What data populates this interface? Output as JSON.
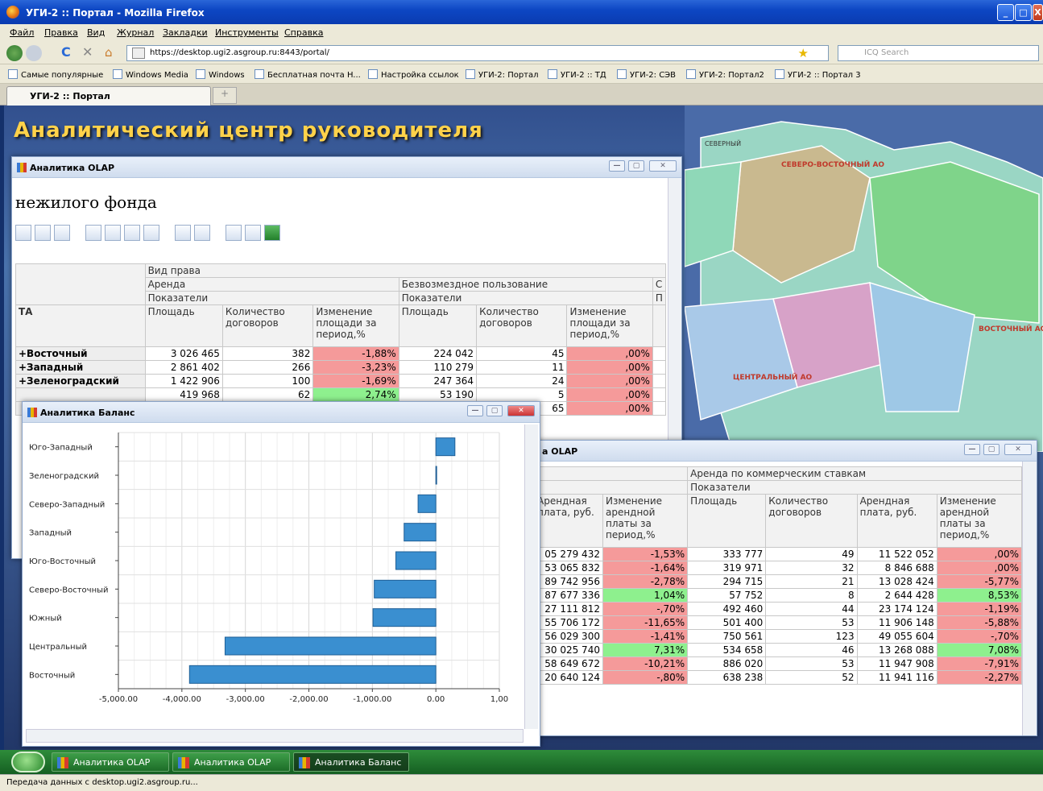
{
  "browser": {
    "title": "УГИ-2 :: Портал - Mozilla Firefox",
    "menu": [
      "Файл",
      "Правка",
      "Вид",
      "Журнал",
      "Закладки",
      "Инструменты",
      "Справка"
    ],
    "url": "https://desktop.ugi2.asgroup.ru:8443/portal/",
    "search_placeholder": "ICQ Search",
    "bookmarks": [
      "Самые популярные",
      "Windows Media",
      "Windows",
      "Бесплатная почта H...",
      "Настройка ссылок",
      "УГИ-2: Портал",
      "УГИ-2 :: ТД",
      "УГИ-2: СЭВ",
      "УГИ-2: Портал2",
      "УГИ-2 :: Портал 3"
    ],
    "tab": "УГИ-2 :: Портал",
    "status": "Передача данных с desktop.ugi2.asgroup.ru..."
  },
  "portal": {
    "title": "Аналитический центр руководителя",
    "map_labels": [
      "СЕВЕРО-ВОСТОЧНЫЙ АО",
      "ВОСТОЧНЫЙ АО",
      "ЦЕНТРАЛЬНЫЙ АО",
      "СЕВЕРНЫЙ"
    ]
  },
  "olap1": {
    "title": "Аналитика OLAP",
    "heading": "нежилого фонда",
    "h1": "Вид права",
    "h2a": "Аренда",
    "h2b": "Безвозмездное пользование",
    "h2c": "С",
    "h3a": "Показатели",
    "h3b": "Показатели",
    "h3c": "П",
    "row_header": "ТА",
    "cols": [
      "Площадь",
      "Количество договоров",
      "Изменение площади за период,%",
      "Площадь",
      "Количество договоров",
      "Изменение площади за период,%"
    ],
    "rows": [
      {
        "name": "+Восточный",
        "c": [
          "3 026 465",
          "382",
          "-1,88%",
          "224 042",
          "45",
          ",00%"
        ]
      },
      {
        "name": "+Западный",
        "c": [
          "2 861 402",
          "266",
          "-3,23%",
          "110 279",
          "11",
          ",00%"
        ]
      },
      {
        "name": "+Зеленоградский",
        "c": [
          "1 422 906",
          "100",
          "-1,69%",
          "247 364",
          "24",
          ",00%"
        ]
      },
      {
        "name": "",
        "c": [
          "419 968",
          "62",
          "2,74%",
          "53 190",
          "5",
          ",00%"
        ]
      },
      {
        "name": "",
        "c": [
          "",
          "",
          "",
          "",
          "65",
          ",00%"
        ]
      }
    ]
  },
  "olap2": {
    "title": "а OLAP",
    "group": "Аренда по коммерческим ставкам",
    "sub": "Показатели",
    "cols": [
      "Арендная плата, руб.",
      "Изменение арендной платы за период,%",
      "Площадь",
      "Количество договоров",
      "Арендная плата, руб.",
      "Изменение арендной платы за период,%"
    ],
    "rows": [
      [
        "05 279 432",
        "-1,53%",
        "333 777",
        "49",
        "11 522 052",
        ",00%"
      ],
      [
        "53 065 832",
        "-1,64%",
        "319 971",
        "32",
        "8 846 688",
        ",00%"
      ],
      [
        "89 742 956",
        "-2,78%",
        "294 715",
        "21",
        "13 028 424",
        "-5,77%"
      ],
      [
        "87 677 336",
        "1,04%",
        "57 752",
        "8",
        "2 644 428",
        "8,53%"
      ],
      [
        "27 111 812",
        "-,70%",
        "492 460",
        "44",
        "23 174 124",
        "-1,19%"
      ],
      [
        "55 706 172",
        "-11,65%",
        "501 400",
        "53",
        "11 906 148",
        "-5,88%"
      ],
      [
        "56 029 300",
        "-1,41%",
        "750 561",
        "123",
        "49 055 604",
        "-,70%"
      ],
      [
        "30 025 740",
        "7,31%",
        "534 658",
        "46",
        "13 268 088",
        "7,08%"
      ],
      [
        "58 649 672",
        "-10,21%",
        "886 020",
        "53",
        "11 947 908",
        "-7,91%"
      ],
      [
        "20 640 124",
        "-,80%",
        "638 238",
        "52",
        "11 941 116",
        "-2,27%"
      ]
    ],
    "colors": [
      [
        "red",
        "red"
      ],
      [
        "red",
        "red"
      ],
      [
        "red",
        "red"
      ],
      [
        "grn",
        "grn"
      ],
      [
        "red",
        "red"
      ],
      [
        "red",
        "red"
      ],
      [
        "red",
        "red"
      ],
      [
        "grn",
        "grn"
      ],
      [
        "red",
        "red"
      ],
      [
        "red",
        "red"
      ]
    ]
  },
  "balance": {
    "title": "Аналитика Баланс",
    "chart_data": {
      "type": "bar",
      "orientation": "horizontal",
      "categories": [
        "Юго-Западный",
        "Зеленоградский",
        "Северо-Западный",
        "Западный",
        "Юго-Восточный",
        "Северо-Восточный",
        "Южный",
        "Центральный",
        "Восточный"
      ],
      "values": [
        300,
        0,
        -280,
        -500,
        -630,
        -970,
        -990,
        -3320,
        -3880
      ],
      "xlim": [
        -5000,
        1000
      ],
      "xticks": [
        "-5,000.00",
        "-4,000.00",
        "-3,000.00",
        "-2,000.00",
        "-1,000.00",
        "0.00",
        "1,00"
      ],
      "grid": true,
      "bar_color": "#3a8fd0"
    }
  },
  "taskbar": {
    "items": [
      "Аналитика OLAP",
      "Аналитика OLAP",
      "Аналитика Баланс"
    ]
  }
}
